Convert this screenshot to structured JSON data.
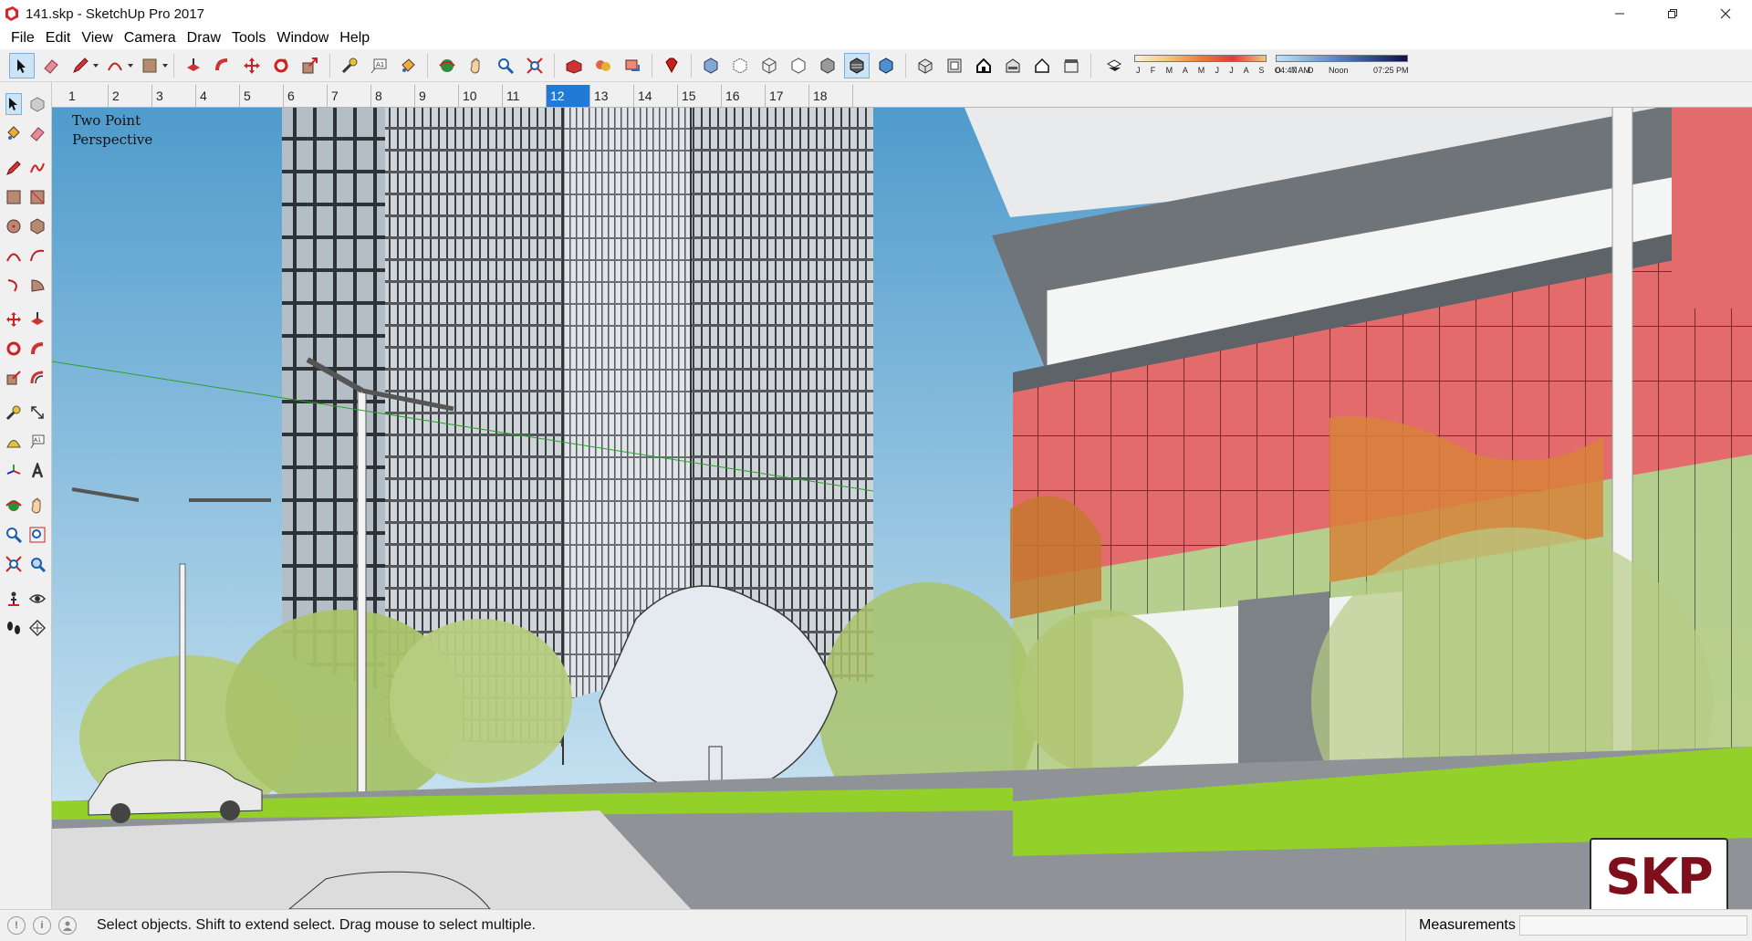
{
  "window": {
    "title": "141.skp - SketchUp Pro 2017"
  },
  "menu": [
    "File",
    "Edit",
    "View",
    "Camera",
    "Draw",
    "Tools",
    "Window",
    "Help"
  ],
  "shadows": {
    "months": "J F M A M J J A S O N D",
    "time_start": "04:47 AM",
    "time_noon": "Noon",
    "time_end": "07:25 PM"
  },
  "scenes": {
    "tabs": [
      "1",
      "2",
      "3",
      "4",
      "5",
      "6",
      "7",
      "8",
      "9",
      "10",
      "11",
      "12",
      "13",
      "14",
      "15",
      "16",
      "17",
      "18"
    ],
    "selected": "12"
  },
  "viewport": {
    "camera_label_line1": "Two Point",
    "camera_label_line2": "Perspective",
    "watermark": "SKP"
  },
  "status": {
    "hint": "Select objects. Shift to extend select. Drag mouse to select multiple.",
    "measurements_label": "Measurements",
    "measurements_value": ""
  },
  "colors": {
    "sky": "#5aa5d3",
    "facade_red": "#e06a6a",
    "grass": "#94d02a",
    "tree_green": "#a9c36a",
    "selected_tab": "#1f7ad8",
    "skp_text": "#800f1c"
  }
}
